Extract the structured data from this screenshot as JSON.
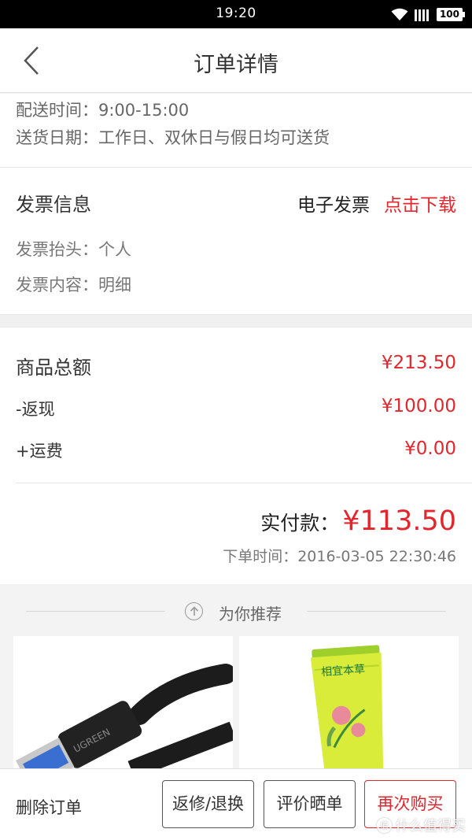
{
  "status_bar": {
    "time": "19:20",
    "battery": "100",
    "icons": [
      "wifi-icon",
      "signal-icon",
      "battery-icon"
    ]
  },
  "header": {
    "title": "订单详情",
    "back_icon": "chevron-left-icon"
  },
  "delivery": {
    "time_line": "配送时间：9:00-15:00",
    "date_line": "送货日期：工作日、双休日与假日均可送货"
  },
  "invoice": {
    "title": "发票信息",
    "type": "电子发票",
    "download_label": "点击下载",
    "header_line": "发票抬头：个人",
    "content_line": "发票内容：明细"
  },
  "totals": {
    "goods_label": "商品总额",
    "goods_amount": "¥213.50",
    "cashback_label": "-返现",
    "cashback_amount": "¥100.00",
    "shipping_label": "+运费",
    "shipping_amount": "¥0.00",
    "paid_label": "实付款：",
    "paid_amount": "¥113.50",
    "order_time": "下单时间：2016-03-05 22:30:46"
  },
  "recommend": {
    "title": "为你推荐",
    "products": [
      {
        "image": "usb-cable",
        "brand_text": "UGREEN"
      },
      {
        "image": "hand-cream-tube",
        "brand_text": "相宜本草"
      }
    ]
  },
  "actions": {
    "delete_label": "删除订单",
    "return_label": "返修/退换",
    "review_label": "评价晒单",
    "rebuy_label": "再次购买"
  },
  "watermark": {
    "text": "什么值得买",
    "icon_char": "值"
  },
  "colors": {
    "accent_red": "#e4262c",
    "background": "#f3f3f3"
  }
}
